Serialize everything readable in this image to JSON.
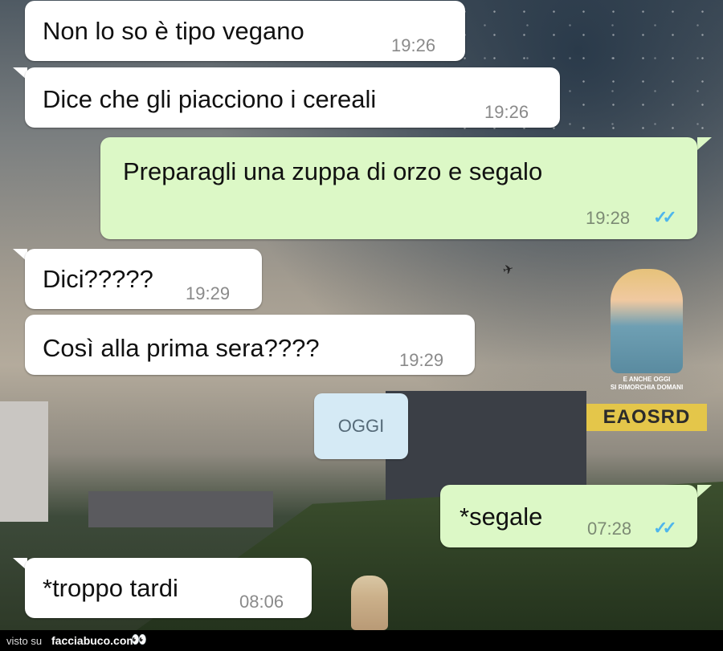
{
  "messages": [
    {
      "text": "Non lo so è tipo vegano",
      "time": "19:26",
      "direction": "in"
    },
    {
      "text": "Dice che gli piacciono i cereali",
      "time": "19:26",
      "direction": "in"
    },
    {
      "text": "Preparagli una zuppa di orzo e segalo",
      "time": "19:28",
      "direction": "out",
      "read": true
    },
    {
      "text": "Dici?????",
      "time": "19:29",
      "direction": "in"
    },
    {
      "text": "Così alla prima sera????",
      "time": "19:29",
      "direction": "in"
    },
    {
      "text": "*segale",
      "time": "07:28",
      "direction": "out",
      "read": true
    },
    {
      "text": "*troppo tardi",
      "time": "08:06",
      "direction": "in"
    }
  ],
  "date_separator": "OGGI",
  "read_ticks": "✓✓",
  "watermark": {
    "caption_line1": "E ANCHE OGGI",
    "caption_line2": "SI RIMORCHIA DOMANI",
    "logo": "EAOSRD"
  },
  "footer": {
    "visto_su": "visto su",
    "site": "facciabuco.com",
    "eyes": "👀"
  },
  "colors": {
    "incoming_bubble": "#ffffff",
    "outgoing_bubble": "#dcf8c6",
    "read_ticks": "#4fb6ec",
    "date_pill": "#d5eaf5"
  }
}
